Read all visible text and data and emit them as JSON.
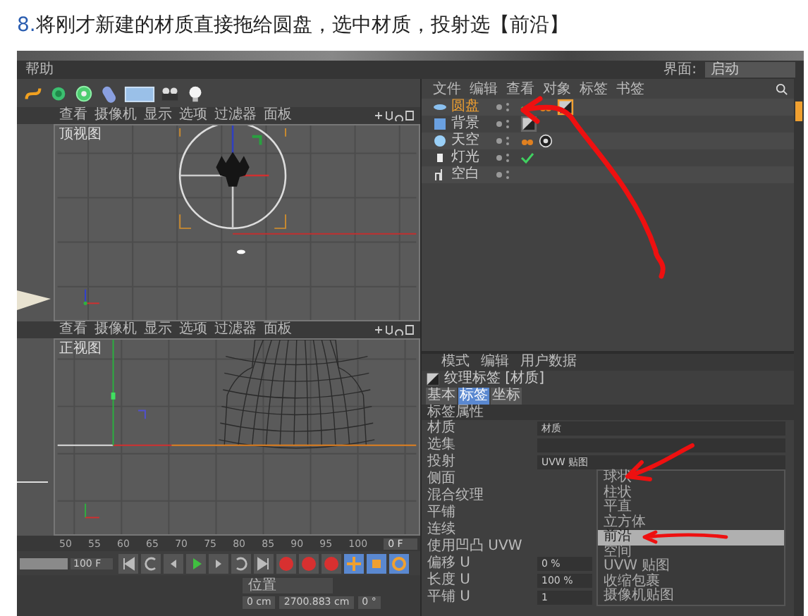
{
  "heading": {
    "number": "8.",
    "text": "将刚才新建的材质直接拖给圆盘，选中材质，投射选【前沿】"
  },
  "menu_bar": {
    "items": [
      "帮助"
    ],
    "layout_label": "界面:",
    "layout_value": "启动"
  },
  "viewports": [
    {
      "menu": [
        "查看",
        "摄像机",
        "显示",
        "选项",
        "过滤器",
        "面板"
      ],
      "label": "顶视图",
      "kind": "top"
    },
    {
      "menu": [
        "查看",
        "摄像机",
        "显示",
        "选项",
        "过滤器",
        "面板"
      ],
      "label": "正视图",
      "kind": "front"
    }
  ],
  "timeline": {
    "range_slider": {
      "level": 1
    },
    "ticks": [
      "50",
      "55",
      "60",
      "65",
      "70",
      "75",
      "80",
      "85",
      "90",
      "95",
      "100"
    ],
    "current_frame": "0 F",
    "end_frame": "100 F"
  },
  "coordinates": {
    "header": "位置",
    "fields": [
      "0 cm",
      "2700.883 cm",
      "0 °"
    ]
  },
  "object_manager": {
    "menu": [
      "文件",
      "编辑",
      "查看",
      "对象",
      "标签",
      "书签"
    ],
    "objects": [
      {
        "name": "圆盘",
        "kind": "disc",
        "selected": true,
        "tags": [
          {
            "kind": "check"
          },
          {
            "kind": "phong"
          },
          {
            "kind": "material",
            "selected": true
          }
        ]
      },
      {
        "name": "背景",
        "kind": "background",
        "selected": false,
        "tags": [
          {
            "kind": "material",
            "selected": false
          }
        ]
      },
      {
        "name": "天空",
        "kind": "sky",
        "selected": false,
        "tags": [
          {
            "kind": "phong"
          },
          {
            "kind": "sky"
          }
        ]
      },
      {
        "name": "灯光",
        "kind": "light",
        "selected": false,
        "tags": [
          {
            "kind": "check"
          }
        ]
      },
      {
        "name": "空白",
        "kind": "null",
        "selected": false
      }
    ]
  },
  "attributes": {
    "menu": [
      "模式",
      "编辑",
      "用户数据"
    ],
    "title": "纹理标签 [材质]",
    "tabs": [
      {
        "label": "基本",
        "selected": false
      },
      {
        "label": "标签",
        "selected": true
      },
      {
        "label": "坐标",
        "selected": false
      }
    ],
    "section": "标签属性",
    "rows": [
      {
        "label": "材质",
        "kind": "link",
        "value": "材质"
      },
      {
        "label": "选集",
        "kind": "field"
      },
      {
        "label": "投射",
        "kind": "dropdown",
        "value": "UVW 贴图"
      },
      {
        "label": "侧面",
        "kind": "plain"
      },
      {
        "label": "混合纹理",
        "kind": "plain"
      },
      {
        "label": "平铺",
        "kind": "plain"
      },
      {
        "label": "连续",
        "kind": "plain"
      },
      {
        "label": "使用凹凸 UVW",
        "kind": "plain"
      },
      {
        "label": "偏移 U",
        "kind": "field",
        "value": "0 %"
      },
      {
        "label": "长度 U",
        "kind": "field",
        "value": "100 %"
      },
      {
        "label": "平铺 U",
        "kind": "field",
        "value": "1"
      }
    ],
    "dropdown_options": [
      {
        "label": "球状",
        "selected": false
      },
      {
        "label": "柱状",
        "selected": false
      },
      {
        "label": "平直",
        "selected": false
      },
      {
        "label": "立方体",
        "selected": false
      },
      {
        "label": "前沿",
        "selected": true
      },
      {
        "label": "空间",
        "selected": false
      },
      {
        "label": "UVW 贴图",
        "selected": false
      },
      {
        "label": "收缩包裹",
        "selected": false
      },
      {
        "label": "摄像机贴图",
        "selected": false
      }
    ]
  }
}
